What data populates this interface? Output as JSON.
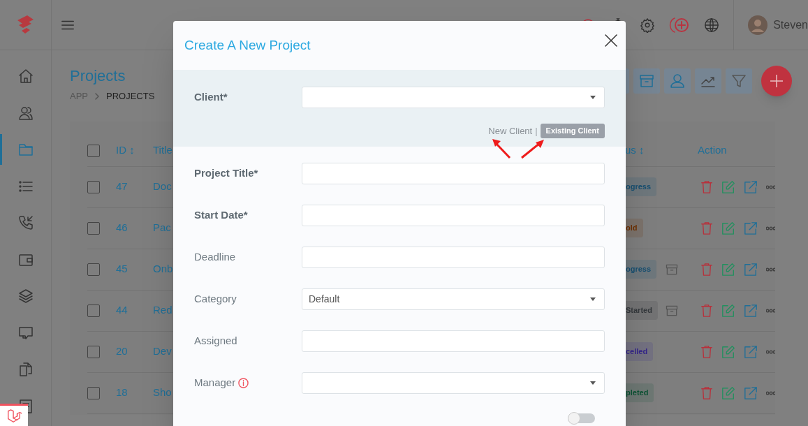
{
  "topbar": {
    "user_name": "Steven"
  },
  "sidebar": {
    "items": [
      {
        "kind": "home",
        "selected": false
      },
      {
        "kind": "users",
        "selected": false
      },
      {
        "kind": "folder",
        "selected": true
      },
      {
        "kind": "list",
        "selected": false
      },
      {
        "kind": "phone",
        "selected": false
      },
      {
        "kind": "wallet",
        "selected": false
      },
      {
        "kind": "layers",
        "selected": false
      },
      {
        "kind": "chat",
        "selected": false
      },
      {
        "kind": "files",
        "selected": false
      },
      {
        "kind": "doc",
        "selected": false
      }
    ]
  },
  "page": {
    "title": "Projects",
    "breadcrumb": [
      "APP",
      "PROJECTS"
    ]
  },
  "table": {
    "select_all": {
      "checked": false
    },
    "columns": [
      "ID ↕",
      "Title",
      "us ↕",
      "Action"
    ],
    "rows": [
      {
        "checked": false,
        "id": "47",
        "title": "Doc",
        "status": {
          "text": "ogress",
          "color": "#164e70"
        },
        "archive": false
      },
      {
        "checked": false,
        "id": "46",
        "title": "Pac",
        "status": {
          "text": "old",
          "color": "#6e2f00"
        },
        "archive": false
      },
      {
        "checked": false,
        "id": "45",
        "title": "Onb",
        "status": {
          "text": "ogress",
          "color": "#164e70"
        },
        "archive": true
      },
      {
        "checked": false,
        "id": "44",
        "title": "Red",
        "status": {
          "text": "Started",
          "color": "#34383c"
        },
        "archive": true
      },
      {
        "checked": false,
        "id": "20",
        "title": "Dev",
        "status": {
          "text": "celled",
          "color": "#35268a"
        },
        "archive": false
      },
      {
        "checked": false,
        "id": "18",
        "title": "Sho",
        "status": {
          "text": "pleted",
          "color": "#0b5233"
        },
        "archive": false
      }
    ]
  },
  "modal": {
    "title": "Create A New Project",
    "client": {
      "label": "Client*",
      "separator": "|",
      "options": [
        {
          "label": "New Client",
          "selected": false
        },
        {
          "label": "Existing Client",
          "selected": true
        }
      ]
    },
    "fields": [
      {
        "label": "Project Title*",
        "required": true,
        "kind": "input"
      },
      {
        "label": "Start Date*",
        "required": true,
        "kind": "input"
      },
      {
        "label": "Deadline",
        "required": false,
        "kind": "input"
      },
      {
        "label": "Category",
        "required": false,
        "kind": "select",
        "value": "Default"
      },
      {
        "label": "Assigned",
        "required": false,
        "kind": "input"
      },
      {
        "label": "Manager",
        "required": false,
        "kind": "select",
        "info": true
      }
    ],
    "billing_toggle": {
      "on": false
    }
  }
}
